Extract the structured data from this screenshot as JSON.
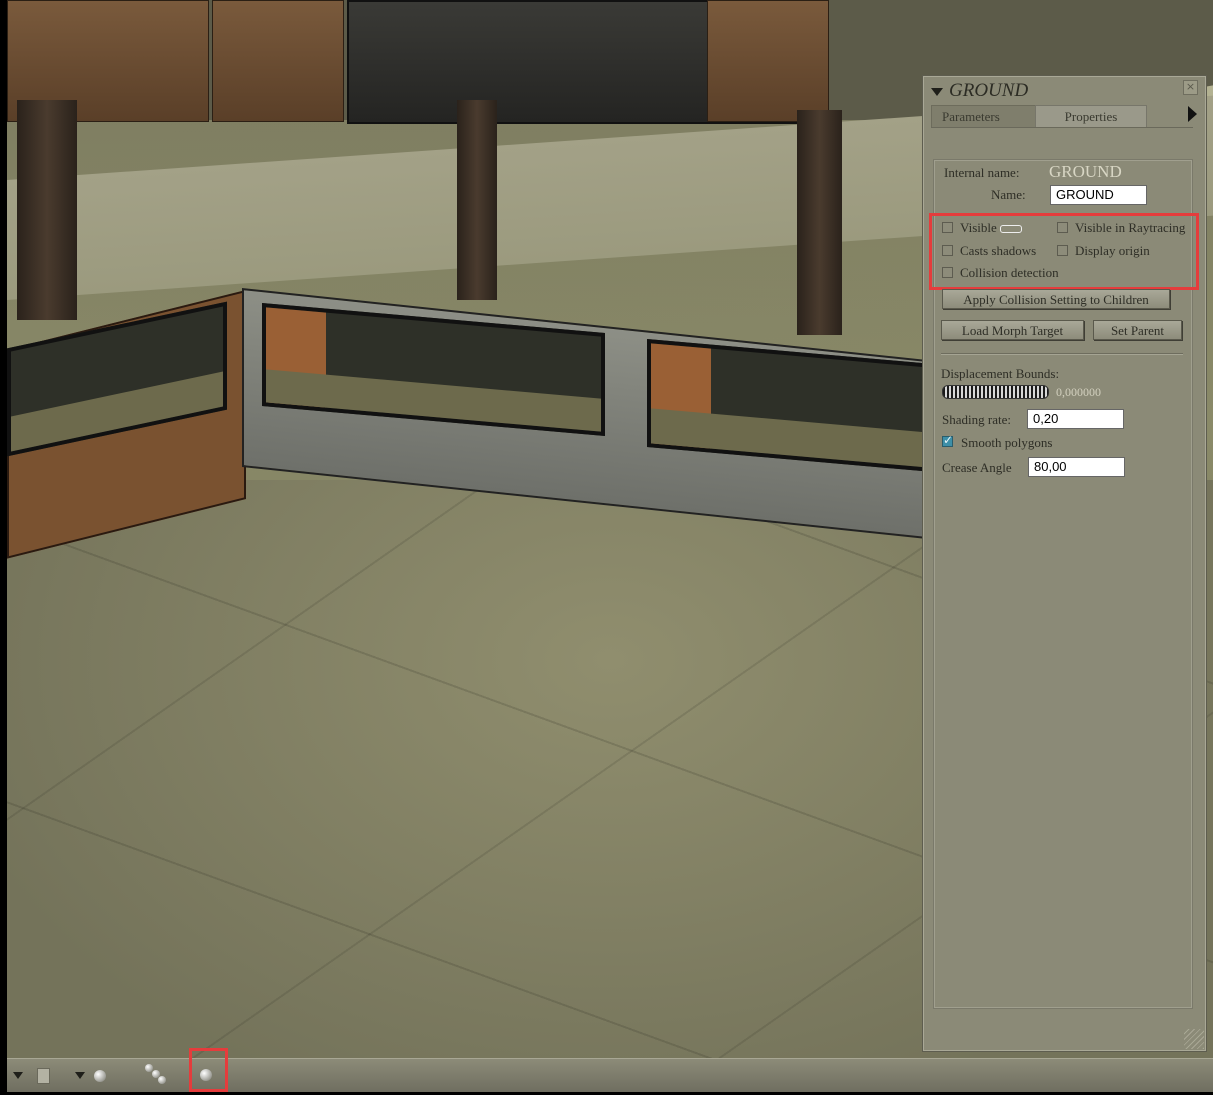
{
  "palette": {
    "title": "GROUND",
    "close_glyph": "×",
    "tabs": [
      {
        "label": "Parameters",
        "active": false
      },
      {
        "label": "Properties",
        "active": true
      }
    ],
    "internal_name_label": "Internal name:",
    "internal_name_value": "GROUND",
    "name_label": "Name:",
    "name_value": "GROUND",
    "checkboxes": {
      "visible": {
        "label": "Visible",
        "checked": false
      },
      "visible_raytracing": {
        "label": "Visible in Raytracing",
        "checked": false
      },
      "casts_shadows": {
        "label": "Casts shadows",
        "checked": false
      },
      "display_origin": {
        "label": "Display origin",
        "checked": false
      },
      "collision_detection": {
        "label": "Collision detection",
        "checked": false
      },
      "smooth_polygons": {
        "label": "Smooth polygons",
        "checked": true
      }
    },
    "buttons": {
      "apply_collision": "Apply Collision Setting to Children",
      "load_morph": "Load Morph Target",
      "set_parent": "Set Parent"
    },
    "displacement_label": "Displacement Bounds:",
    "displacement_value": "0,000000",
    "shading_rate_label": "Shading rate:",
    "shading_rate_value": "0,20",
    "crease_angle_label": "Crease Angle",
    "crease_angle_value": "80,00"
  },
  "bottombar": {
    "icons": [
      "dropdown-icon",
      "box-icon",
      "dropdown-icon",
      "light-ball-icon",
      "particles-icon",
      "sphere-icon"
    ]
  },
  "colors": {
    "highlight": "#e53c3c",
    "palette_bg": "#8b8a77"
  }
}
